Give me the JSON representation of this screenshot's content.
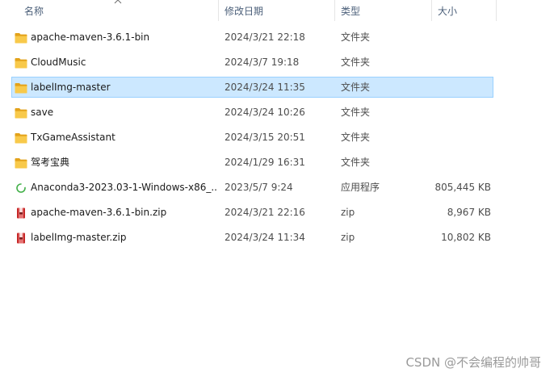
{
  "columns": {
    "name": "名称",
    "date": "修改日期",
    "type": "类型",
    "size": "大小"
  },
  "files": [
    {
      "name": "apache-maven-3.6.1-bin",
      "date": "2024/3/21 22:18",
      "type": "文件夹",
      "size": "",
      "icon": "folder-icon",
      "selected": false
    },
    {
      "name": "CloudMusic",
      "date": "2024/3/7 19:18",
      "type": "文件夹",
      "size": "",
      "icon": "folder-icon",
      "selected": false
    },
    {
      "name": "labelImg-master",
      "date": "2024/3/24 11:35",
      "type": "文件夹",
      "size": "",
      "icon": "folder-icon",
      "selected": true
    },
    {
      "name": "save",
      "date": "2024/3/24 10:26",
      "type": "文件夹",
      "size": "",
      "icon": "folder-icon",
      "selected": false
    },
    {
      "name": "TxGameAssistant",
      "date": "2024/3/15 20:51",
      "type": "文件夹",
      "size": "",
      "icon": "folder-icon",
      "selected": false
    },
    {
      "name": "驾考宝典",
      "date": "2024/1/29 16:31",
      "type": "文件夹",
      "size": "",
      "icon": "folder-icon",
      "selected": false
    },
    {
      "name": "Anaconda3-2023.03-1-Windows-x86_...",
      "date": "2023/5/7 9:24",
      "type": "应用程序",
      "size": "805,445 KB",
      "icon": "installer-icon",
      "selected": false
    },
    {
      "name": "apache-maven-3.6.1-bin.zip",
      "date": "2024/3/21 22:16",
      "type": "zip",
      "size": "8,967 KB",
      "icon": "zip-archive-icon",
      "selected": false
    },
    {
      "name": "labelImg-master.zip",
      "date": "2024/3/24 11:34",
      "type": "zip",
      "size": "10,802 KB",
      "icon": "zip-archive-icon",
      "selected": false
    }
  ],
  "watermark": "CSDN @不会编程的帅哥",
  "colors": {
    "selection_bg": "#cce8ff",
    "selection_border": "#99d1ff",
    "folder": "#f8c94a",
    "zip": "#c62828"
  }
}
